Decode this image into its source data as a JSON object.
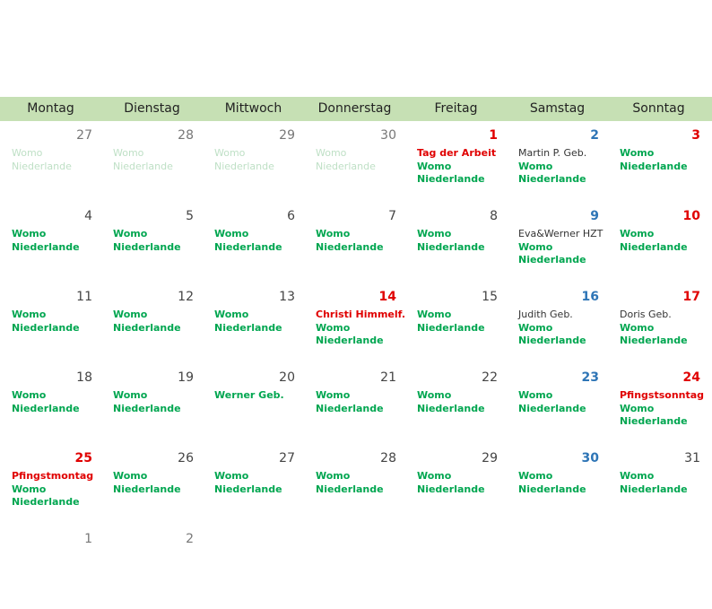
{
  "weekdays": [
    "Montag",
    "Dienstag",
    "Mittwoch",
    "Donnerstag",
    "Freitag",
    "Samstag",
    "Sonntag"
  ],
  "weeks": [
    [
      {
        "num": "27",
        "kind": "other",
        "events": [
          {
            "text": "Womo",
            "style": "faded"
          },
          {
            "text": "Niederlande",
            "style": "faded"
          }
        ]
      },
      {
        "num": "28",
        "kind": "other",
        "events": [
          {
            "text": "Womo",
            "style": "faded"
          },
          {
            "text": "Niederlande",
            "style": "faded"
          }
        ]
      },
      {
        "num": "29",
        "kind": "other",
        "events": [
          {
            "text": "Womo",
            "style": "faded"
          },
          {
            "text": "Niederlande",
            "style": "faded"
          }
        ]
      },
      {
        "num": "30",
        "kind": "other",
        "events": [
          {
            "text": "Womo",
            "style": "faded"
          },
          {
            "text": "Niederlande",
            "style": "faded"
          }
        ]
      },
      {
        "num": "1",
        "kind": "hol",
        "events": [
          {
            "text": "Tag der Arbeit",
            "style": "red"
          },
          {
            "text": "Womo",
            "style": "green"
          },
          {
            "text": "Niederlande",
            "style": "green"
          }
        ]
      },
      {
        "num": "2",
        "kind": "sat",
        "events": [
          {
            "text": "Martin P. Geb.",
            "style": "dark"
          },
          {
            "text": "Womo",
            "style": "green"
          },
          {
            "text": "Niederlande",
            "style": "green"
          }
        ]
      },
      {
        "num": "3",
        "kind": "sun",
        "events": [
          {
            "text": "Womo",
            "style": "green"
          },
          {
            "text": "Niederlande",
            "style": "green"
          }
        ]
      }
    ],
    [
      {
        "num": "4",
        "kind": "normal",
        "events": [
          {
            "text": "Womo",
            "style": "green"
          },
          {
            "text": "Niederlande",
            "style": "green"
          }
        ]
      },
      {
        "num": "5",
        "kind": "normal",
        "events": [
          {
            "text": "Womo",
            "style": "green"
          },
          {
            "text": "Niederlande",
            "style": "green"
          }
        ]
      },
      {
        "num": "6",
        "kind": "normal",
        "events": [
          {
            "text": "Womo",
            "style": "green"
          },
          {
            "text": "Niederlande",
            "style": "green"
          }
        ]
      },
      {
        "num": "7",
        "kind": "normal",
        "events": [
          {
            "text": "Womo",
            "style": "green"
          },
          {
            "text": "Niederlande",
            "style": "green"
          }
        ]
      },
      {
        "num": "8",
        "kind": "normal",
        "events": [
          {
            "text": "Womo",
            "style": "green"
          },
          {
            "text": "Niederlande",
            "style": "green"
          }
        ]
      },
      {
        "num": "9",
        "kind": "sat",
        "events": [
          {
            "text": "Eva&Werner HZT",
            "style": "dark"
          },
          {
            "text": "Womo",
            "style": "green"
          },
          {
            "text": "Niederlande",
            "style": "green"
          }
        ]
      },
      {
        "num": "10",
        "kind": "sun",
        "events": [
          {
            "text": "Womo",
            "style": "green"
          },
          {
            "text": "Niederlande",
            "style": "green"
          }
        ]
      }
    ],
    [
      {
        "num": "11",
        "kind": "normal",
        "events": [
          {
            "text": "Womo",
            "style": "green"
          },
          {
            "text": "Niederlande",
            "style": "green"
          }
        ]
      },
      {
        "num": "12",
        "kind": "normal",
        "events": [
          {
            "text": "Womo",
            "style": "green"
          },
          {
            "text": "Niederlande",
            "style": "green"
          }
        ]
      },
      {
        "num": "13",
        "kind": "normal",
        "events": [
          {
            "text": "Womo",
            "style": "green"
          },
          {
            "text": "Niederlande",
            "style": "green"
          }
        ]
      },
      {
        "num": "14",
        "kind": "hol",
        "events": [
          {
            "text": "Christi Himmelf.",
            "style": "red"
          },
          {
            "text": "Womo",
            "style": "green"
          },
          {
            "text": "Niederlande",
            "style": "green"
          }
        ]
      },
      {
        "num": "15",
        "kind": "normal",
        "events": [
          {
            "text": "Womo",
            "style": "green"
          },
          {
            "text": "Niederlande",
            "style": "green"
          }
        ]
      },
      {
        "num": "16",
        "kind": "sat",
        "events": [
          {
            "text": "Judith Geb.",
            "style": "dark"
          },
          {
            "text": "Womo",
            "style": "green"
          },
          {
            "text": "Niederlande",
            "style": "green"
          }
        ]
      },
      {
        "num": "17",
        "kind": "sun",
        "events": [
          {
            "text": "Doris Geb.",
            "style": "dark"
          },
          {
            "text": "Womo",
            "style": "green"
          },
          {
            "text": "Niederlande",
            "style": "green"
          }
        ]
      }
    ],
    [
      {
        "num": "18",
        "kind": "normal",
        "events": [
          {
            "text": "Womo",
            "style": "green"
          },
          {
            "text": "Niederlande",
            "style": "green"
          }
        ]
      },
      {
        "num": "19",
        "kind": "normal",
        "events": [
          {
            "text": "Womo",
            "style": "green"
          },
          {
            "text": "Niederlande",
            "style": "green"
          }
        ]
      },
      {
        "num": "20",
        "kind": "normal",
        "events": [
          {
            "text": "Werner Geb.",
            "style": "green"
          }
        ]
      },
      {
        "num": "21",
        "kind": "normal",
        "events": [
          {
            "text": "Womo",
            "style": "green"
          },
          {
            "text": "Niederlande",
            "style": "green"
          }
        ]
      },
      {
        "num": "22",
        "kind": "normal",
        "events": [
          {
            "text": "Womo",
            "style": "green"
          },
          {
            "text": "Niederlande",
            "style": "green"
          }
        ]
      },
      {
        "num": "23",
        "kind": "sat",
        "events": [
          {
            "text": "Womo",
            "style": "green"
          },
          {
            "text": "Niederlande",
            "style": "green"
          }
        ]
      },
      {
        "num": "24",
        "kind": "sun",
        "events": [
          {
            "text": "Pfingstsonntag",
            "style": "red"
          },
          {
            "text": "Womo",
            "style": "green"
          },
          {
            "text": "Niederlande",
            "style": "green"
          }
        ]
      }
    ],
    [
      {
        "num": "25",
        "kind": "hol",
        "events": [
          {
            "text": "Pfingstmontag",
            "style": "red"
          },
          {
            "text": "Womo",
            "style": "green"
          },
          {
            "text": "Niederlande",
            "style": "green"
          }
        ]
      },
      {
        "num": "26",
        "kind": "normal",
        "events": [
          {
            "text": "Womo",
            "style": "green"
          },
          {
            "text": "Niederlande",
            "style": "green"
          }
        ]
      },
      {
        "num": "27",
        "kind": "normal",
        "events": [
          {
            "text": "Womo",
            "style": "green"
          },
          {
            "text": "Niederlande",
            "style": "green"
          }
        ]
      },
      {
        "num": "28",
        "kind": "normal",
        "events": [
          {
            "text": "Womo",
            "style": "green"
          },
          {
            "text": "Niederlande",
            "style": "green"
          }
        ]
      },
      {
        "num": "29",
        "kind": "normal",
        "events": [
          {
            "text": "Womo",
            "style": "green"
          },
          {
            "text": "Niederlande",
            "style": "green"
          }
        ]
      },
      {
        "num": "30",
        "kind": "sat",
        "events": [
          {
            "text": "Womo",
            "style": "green"
          },
          {
            "text": "Niederlande",
            "style": "green"
          }
        ]
      },
      {
        "num": "31",
        "kind": "normal",
        "events": [
          {
            "text": "Womo",
            "style": "green"
          },
          {
            "text": "Niederlande",
            "style": "green"
          }
        ]
      }
    ],
    [
      {
        "num": "1",
        "kind": "other",
        "events": []
      },
      {
        "num": "2",
        "kind": "other",
        "events": []
      }
    ]
  ],
  "colors": {
    "header_bg": "#c6e0b4",
    "event_green": "#00a650",
    "holiday_red": "#e00000",
    "saturday_blue": "#2e75b6"
  }
}
